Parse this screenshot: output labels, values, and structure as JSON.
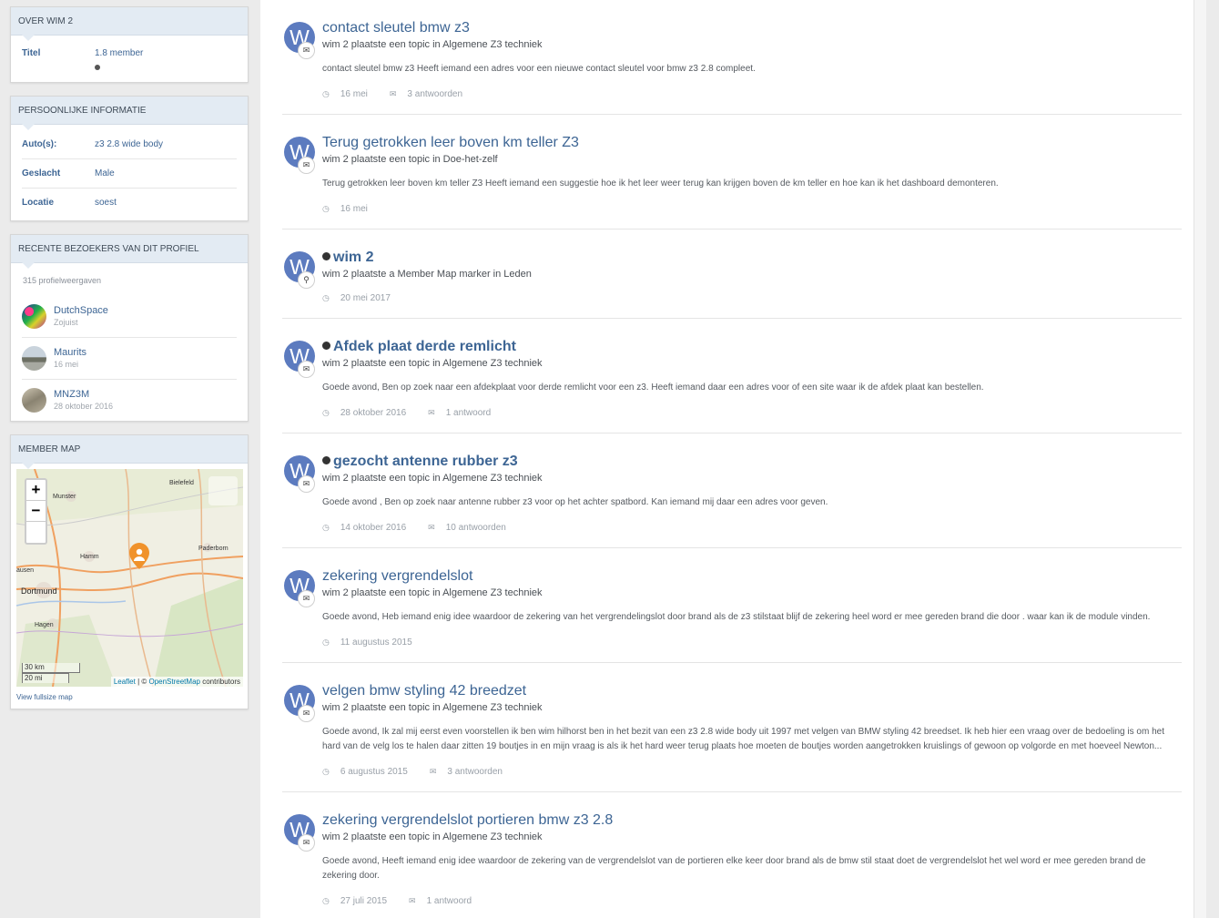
{
  "about": {
    "title": "Over wim 2",
    "rows": [
      {
        "key": "Titel",
        "value": "1.8 member"
      }
    ]
  },
  "personal": {
    "title": "Persoonlijke informatie",
    "rows": [
      {
        "key": "Auto(s):",
        "value": "z3 2.8 wide body"
      },
      {
        "key": "Geslacht",
        "value": "Male"
      },
      {
        "key": "Locatie",
        "value": "soest"
      }
    ]
  },
  "visitors": {
    "title": "Recente bezoekers van dit profiel",
    "views": "315 profielweergaven",
    "items": [
      {
        "name": "DutchSpace",
        "time": "Zojuist"
      },
      {
        "name": "Maurits",
        "time": "16 mei"
      },
      {
        "name": "MNZ3M",
        "time": "28 oktober 2016"
      }
    ]
  },
  "member_map": {
    "title": "Member map",
    "zoom_in": "+",
    "zoom_out": "−",
    "places": [
      "Bielefeld",
      "Munster",
      "Hamm",
      "Paderborn",
      "Dortmund",
      "Hagen",
      "ausen"
    ],
    "scale_km": "30 km",
    "scale_mi": "20 mi",
    "attrib_leaflet": "Leaflet",
    "attrib_sep": " | © ",
    "attrib_osm": "OpenStreetMap",
    "attrib_contrib": " contributors",
    "fullsize": "View fullsize map"
  },
  "feed": [
    {
      "avatar": "W",
      "badge": "comments-icon",
      "unread": false,
      "title": "contact sleutel bmw z3",
      "meta": "wim 2 plaatste een topic in Algemene Z3 techniek",
      "excerpt": "contact sleutel bmw z3 Heeft iemand een adres voor een nieuwe contact sleutel voor bmw z3 2.8 compleet.",
      "date": "16 mei",
      "replies": "3 antwoorden"
    },
    {
      "avatar": "W",
      "badge": "comments-icon",
      "unread": false,
      "title": "Terug getrokken leer boven km teller Z3",
      "meta": "wim 2 plaatste een topic in Doe-het-zelf",
      "excerpt": "Terug getrokken leer boven km teller Z3 Heeft iemand een suggestie hoe ik het leer weer terug kan krijgen boven de km teller en hoe kan ik het dashboard demonteren.",
      "date": "16 mei",
      "replies": ""
    },
    {
      "avatar": "W",
      "badge": "map-marker-icon",
      "unread": true,
      "title": "wim 2",
      "meta": "wim 2 plaatste a Member Map marker in Leden",
      "excerpt": "",
      "date": "20 mei 2017",
      "replies": ""
    },
    {
      "avatar": "W",
      "badge": "comments-icon",
      "unread": true,
      "title": "Afdek plaat derde remlicht",
      "meta": "wim 2 plaatste een topic in Algemene Z3 techniek",
      "excerpt": "Goede avond, Ben op zoek naar een afdekplaat voor derde remlicht voor een z3. Heeft iemand daar een adres voor of een site waar ik de afdek plaat kan bestellen.",
      "date": "28 oktober 2016",
      "replies": "1 antwoord"
    },
    {
      "avatar": "W",
      "badge": "comments-icon",
      "unread": true,
      "title": "gezocht antenne rubber z3",
      "meta": "wim 2 plaatste een topic in Algemene Z3 techniek",
      "excerpt": "Goede avond , Ben op zoek naar antenne rubber z3 voor op het achter spatbord. Kan iemand mij daar een adres voor geven.",
      "date": "14 oktober 2016",
      "replies": "10 antwoorden"
    },
    {
      "avatar": "W",
      "badge": "comments-icon",
      "unread": false,
      "title": "zekering vergrendelslot",
      "meta": "wim 2 plaatste een topic in Algemene Z3 techniek",
      "excerpt": "Goede avond, Heb iemand enig idee waardoor de zekering van het vergrendelingslot door brand als de z3 stilstaat blijf de zekering heel word er mee gereden brand die door . waar kan ik de module vinden.",
      "date": "11 augustus 2015",
      "replies": ""
    },
    {
      "avatar": "W",
      "badge": "comments-icon",
      "unread": false,
      "title": "velgen bmw styling 42 breedzet",
      "meta": "wim 2 plaatste een topic in Algemene Z3 techniek",
      "excerpt": "Goede avond, Ik zal mij eerst even voorstellen ik ben wim hilhorst ben in het bezit van een z3 2.8 wide body uit 1997 met velgen van BMW styling 42 breedset. Ik heb hier een vraag over de bedoeling is om het hard van de velg los te halen daar zitten 19 boutjes in en mijn vraag is als ik het hard weer terug plaats hoe moeten de boutjes worden aangetrokken kruislings of gewoon op volgorde en met hoeveel Newton...",
      "date": "6 augustus 2015",
      "replies": "3 antwoorden"
    },
    {
      "avatar": "W",
      "badge": "comments-icon",
      "unread": false,
      "title": "zekering vergrendelslot portieren bmw z3 2.8",
      "meta": "wim 2 plaatste een topic in Algemene Z3 techniek",
      "excerpt": "Goede avond, Heeft iemand enig idee waardoor de zekering van de vergrendelslot van de portieren elke keer door brand als de bmw stil staat doet de vergrendelslot het wel word er mee gereden brand de zekering door.",
      "date": "27 juli 2015",
      "replies": "1 antwoord"
    }
  ]
}
